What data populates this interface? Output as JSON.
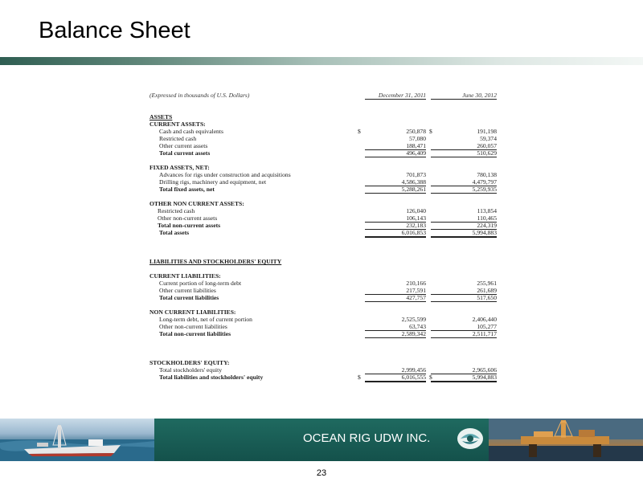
{
  "title": "Balance Sheet",
  "sheet": {
    "unit_note": "(Expressed in thousands of U.S. Dollars)",
    "col_current": "December 31, 2011",
    "col_prior": "June 30, 2012",
    "rows": [
      {
        "label": "ASSETS",
        "style": "bold u",
        "cur": "",
        "prev": ""
      },
      {
        "label": "CURRENT ASSETS:",
        "style": "bold",
        "cur": "",
        "prev": ""
      },
      {
        "label": "Cash and cash equivalents",
        "style": "ind1",
        "dol": true,
        "cur": "250,878",
        "prev": "191,198"
      },
      {
        "label": "Restricted cash",
        "style": "ind1",
        "cur": "57,080",
        "prev": "59,374"
      },
      {
        "label": "Other current assets",
        "style": "ind1 lt",
        "cur": "188,471",
        "prev": "260,057"
      },
      {
        "label": "Total current assets",
        "style": "ind1 bold lt",
        "cur": "496,409",
        "prev": "510,629"
      },
      {
        "label": "",
        "style": "gap",
        "cur": "",
        "prev": ""
      },
      {
        "label": "FIXED ASSETS, NET:",
        "style": "bold",
        "cur": "",
        "prev": ""
      },
      {
        "label": "Advances for rigs under construction and acquisitions",
        "style": "ind1",
        "cur": "701,873",
        "prev": "780,138"
      },
      {
        "label": "Drilling rigs, machinery and equipment, net",
        "style": "ind1 lt",
        "cur": "4,586,388",
        "prev": "4,479,797"
      },
      {
        "label": "Total fixed assets, net",
        "style": "ind1 bold lt",
        "cur": "5,288,261",
        "prev": "5,259,935"
      },
      {
        "label": "",
        "style": "gap",
        "cur": "",
        "prev": ""
      },
      {
        "label": "OTHER NON CURRENT ASSETS:",
        "style": "bold",
        "cur": "",
        "prev": ""
      },
      {
        "label": "Restricted cash",
        "style": "ind2",
        "cur": "126,040",
        "prev": "113,854"
      },
      {
        "label": "Other non-current assets",
        "style": "ind2 lt",
        "cur": "106,143",
        "prev": "110,465"
      },
      {
        "label": "Total non-current assets",
        "style": "ind2 bold lt",
        "cur": "232,183",
        "prev": "224,319"
      },
      {
        "label": "Total assets",
        "style": "ind1 bold dt",
        "cur": "6,016,853",
        "prev": "5,994,883"
      },
      {
        "label": "",
        "style": "gap2",
        "cur": "",
        "prev": ""
      },
      {
        "label": "LIABILITIES AND STOCKHOLDERS' EQUITY",
        "style": "bold u",
        "cur": "",
        "prev": ""
      },
      {
        "label": "",
        "style": "gap",
        "cur": "",
        "prev": ""
      },
      {
        "label": "CURRENT LIABILITIES:",
        "style": "bold",
        "cur": "",
        "prev": ""
      },
      {
        "label": "Current portion of long-term debt",
        "style": "ind1",
        "cur": "210,166",
        "prev": "255,961"
      },
      {
        "label": "Other current liabilities",
        "style": "ind1 lt",
        "cur": "217,591",
        "prev": "261,689"
      },
      {
        "label": "Total current liabilities",
        "style": "ind1 bold lt",
        "cur": "427,757",
        "prev": "517,650"
      },
      {
        "label": "",
        "style": "gap",
        "cur": "",
        "prev": ""
      },
      {
        "label": "NON CURRENT LIABILITIES:",
        "style": "bold",
        "cur": "",
        "prev": ""
      },
      {
        "label": "Long-term debt, net of current portion",
        "style": "ind1",
        "cur": "2,525,599",
        "prev": "2,406,440"
      },
      {
        "label": "Other non-current liabilities",
        "style": "ind1 lt",
        "cur": "63,743",
        "prev": "105,277"
      },
      {
        "label": "Total non-current liabilities",
        "style": "ind1 bold lt",
        "cur": "2,589,342",
        "prev": "2,511,717"
      },
      {
        "label": "",
        "style": "gap2",
        "cur": "",
        "prev": ""
      },
      {
        "label": "STOCKHOLDERS' EQUITY:",
        "style": "bold",
        "cur": "",
        "prev": ""
      },
      {
        "label": "Total stockholders' equity",
        "style": "ind1 lt",
        "cur": "2,999,456",
        "prev": "2,965,606"
      },
      {
        "label": "Total liabilities and stockholders' equity",
        "style": "ind1 bold dt",
        "dol": true,
        "cur": "6,016,555",
        "prev": "5,994,883"
      }
    ]
  },
  "footer": {
    "company": "OCEAN RIG UDW INC.",
    "page_number": "23"
  }
}
